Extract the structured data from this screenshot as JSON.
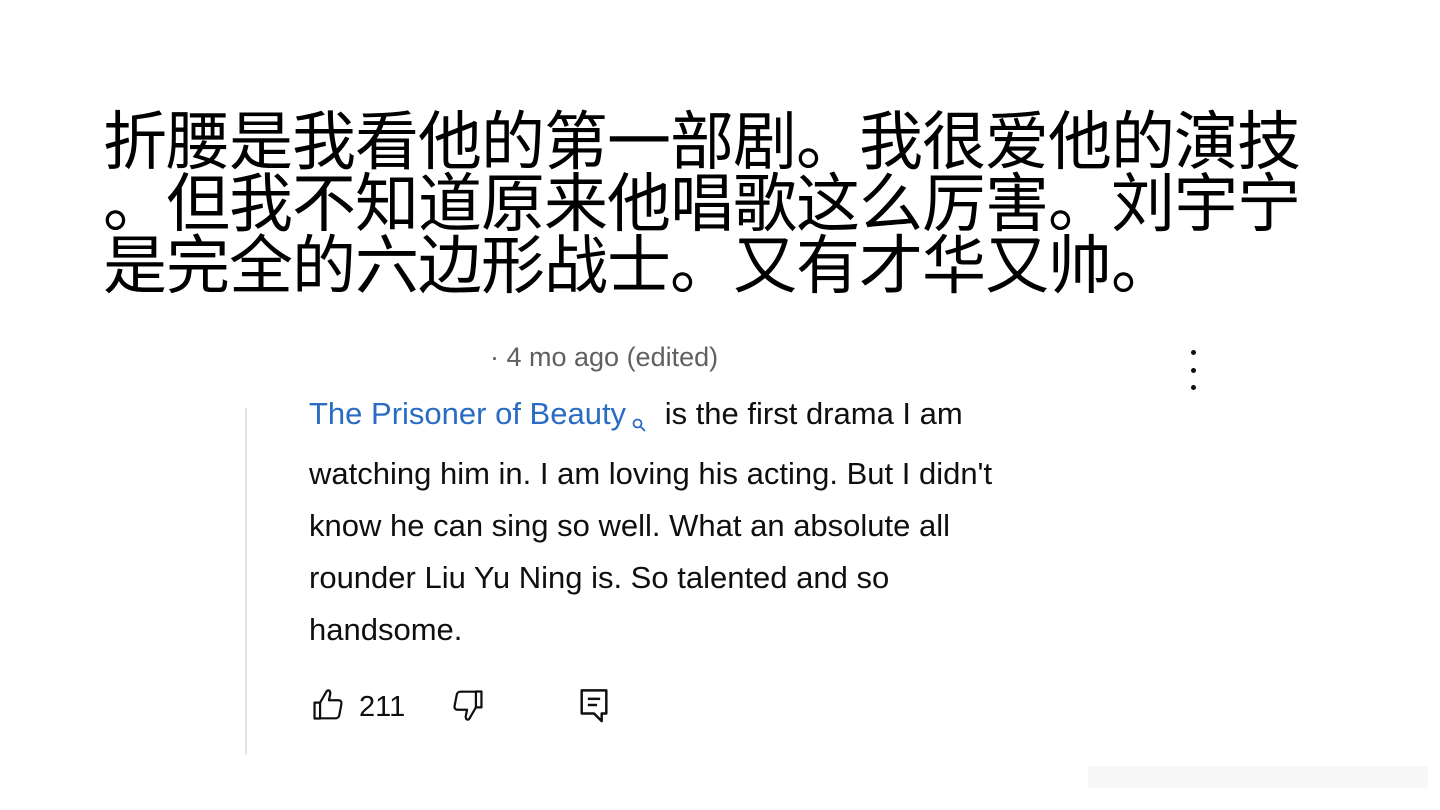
{
  "caption": {
    "lines": [
      "折腰是我看他的第一部剧。我很爱他的演技",
      "。但我不知道原来他唱歌这么厉害。刘宇宁",
      "是完全的六边形战士。又有才华又帅。"
    ]
  },
  "comment": {
    "meta": "· 4 mo ago (edited)",
    "link_text": "The Prisoner of Beauty",
    "lines_first_tail": "is the first drama I am",
    "lines": [
      "watching him in. I am loving his acting. But I didn't",
      "know he can sing so well. What an absolute all",
      "rounder Liu Yu Ning is. So talented and so",
      "handsome."
    ],
    "like_count": "211"
  },
  "icons": {
    "menu": "more-vert-icon",
    "search": "search-icon",
    "like": "thumbs-up-icon",
    "dislike": "thumbs-down-icon",
    "reply": "reply-comment-icon"
  },
  "colors": {
    "link": "#2a6cc4",
    "text": "#0f0f0f",
    "meta": "#606060"
  }
}
